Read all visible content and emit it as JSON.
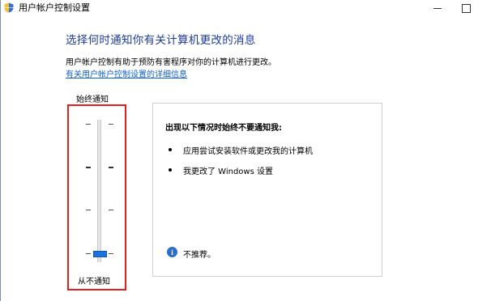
{
  "window": {
    "title": "用户帐户控制设置"
  },
  "header": {
    "heading": "选择何时通知你有关计算机更改的消息",
    "description": "用户帐户控制有助于预防有害程序对你的计算机进行更改。",
    "link": "有关用户帐户控制设置的详细信息"
  },
  "slider": {
    "top_label": "始终通知",
    "bottom_label": "从不通知",
    "levels": 4,
    "selected_level": 1,
    "thumb_color": "#1a73d9",
    "highlight_color": "#e02020"
  },
  "panel": {
    "title": "出现以下情况时始终不要通知我:",
    "items": [
      "应用尝试安装软件或更改我的计算机",
      "我更改了 Windows 设置"
    ],
    "note": "不推荐。"
  },
  "icons": {
    "title": "shield-icon",
    "info": "info-icon"
  },
  "colors": {
    "heading": "#1e3c9a",
    "link": "#1060c0"
  }
}
